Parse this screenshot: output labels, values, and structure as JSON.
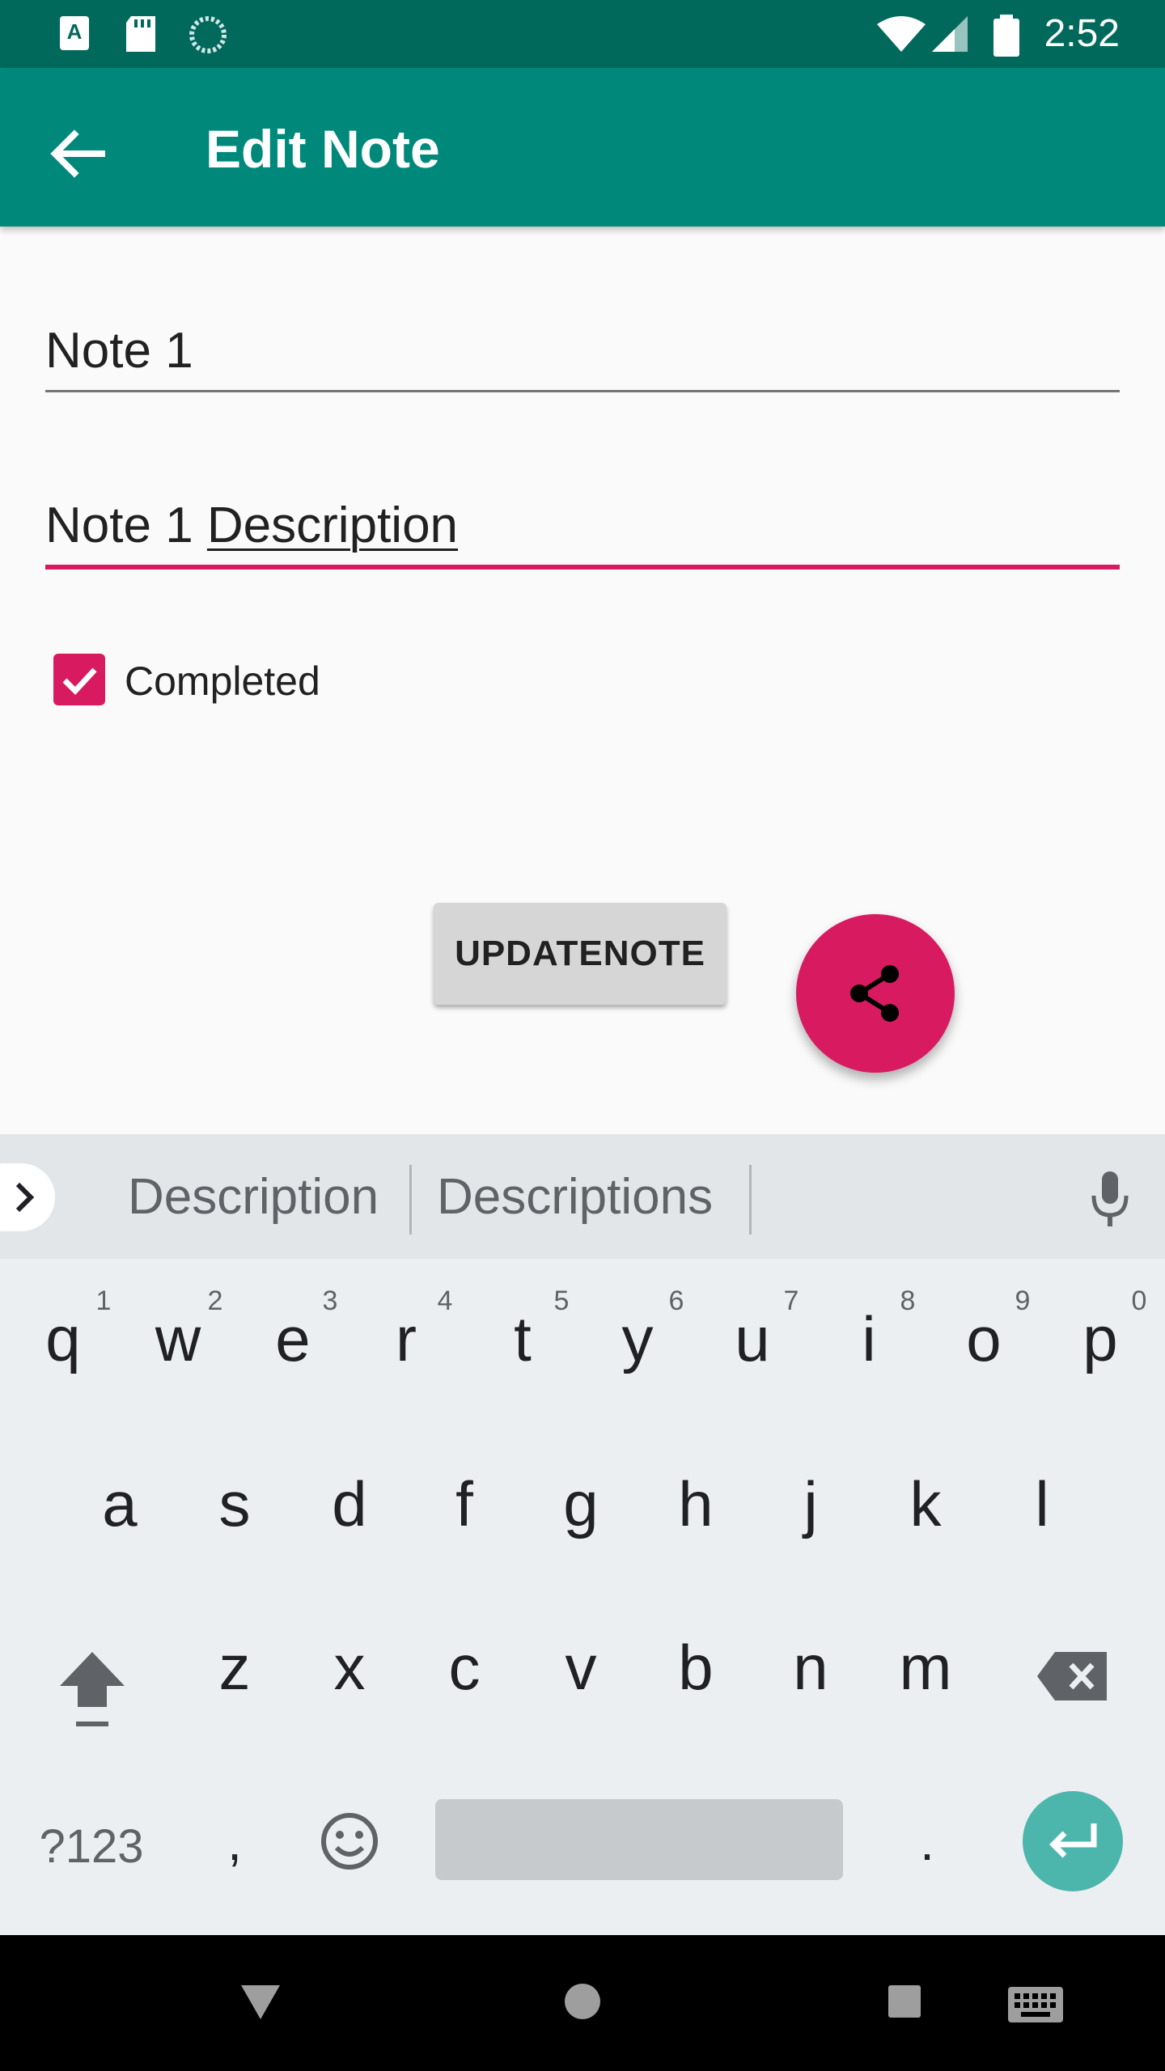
{
  "status_bar": {
    "time": "2:52"
  },
  "app_bar": {
    "title": "Edit Note"
  },
  "form": {
    "title_value": "Note 1",
    "description_prefix": "Note 1 ",
    "description_suffix": "Description",
    "checkbox_label": "Completed",
    "checkbox_checked": true
  },
  "buttons": {
    "update_label": "UPDATENOTE"
  },
  "keyboard": {
    "suggestions": [
      "Description",
      "Descriptions"
    ],
    "row1": [
      "q",
      "w",
      "e",
      "r",
      "t",
      "y",
      "u",
      "i",
      "o",
      "p"
    ],
    "row1_hints": [
      "1",
      "2",
      "3",
      "4",
      "5",
      "6",
      "7",
      "8",
      "9",
      "0"
    ],
    "row2": [
      "a",
      "s",
      "d",
      "f",
      "g",
      "h",
      "j",
      "k",
      "l"
    ],
    "row3": [
      "z",
      "x",
      "c",
      "v",
      "b",
      "n",
      "m"
    ],
    "symbols_label": "?123",
    "comma": ",",
    "period": "."
  },
  "colors": {
    "primary": "#00897b",
    "primary_dark": "#00695c",
    "accent": "#d81b60",
    "enter": "#4db6ac"
  }
}
